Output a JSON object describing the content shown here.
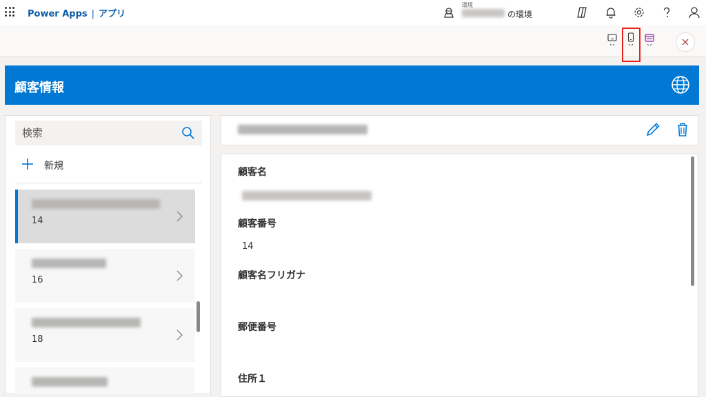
{
  "topbar": {
    "app_name": "Power Apps",
    "separator": "|",
    "section": "アプリ",
    "env_label": "環境",
    "env_suffix": "の環境"
  },
  "banner": {
    "title": "顧客情報"
  },
  "search": {
    "placeholder": "検索"
  },
  "new_button": {
    "label": "新規"
  },
  "list": {
    "items": [
      {
        "number": "14",
        "selected": true
      },
      {
        "number": "16",
        "selected": false
      },
      {
        "number": "18",
        "selected": false
      },
      {
        "number": "",
        "selected": false
      }
    ]
  },
  "form": {
    "fields": [
      {
        "label": "顧客名",
        "value": ""
      },
      {
        "label": "顧客番号",
        "value": "14"
      },
      {
        "label": "顧客名フリガナ",
        "value": ""
      },
      {
        "label": "郵便番号",
        "value": ""
      },
      {
        "label": "住所１",
        "value": ""
      }
    ]
  },
  "colors": {
    "brand_blue": "#0078d4",
    "link_blue": "#0f5ea8",
    "highlight_red": "#e8201b",
    "close_x": "#a4262c"
  },
  "icons": [
    "waffle-icon",
    "environment-icon",
    "copilot-icon",
    "bell-icon",
    "gear-icon",
    "help-icon",
    "user-icon",
    "tablet-icon",
    "phone-icon",
    "web-icon",
    "close-icon",
    "globe-icon",
    "search-icon",
    "plus-icon",
    "chevron-right-icon",
    "edit-icon",
    "delete-icon"
  ]
}
